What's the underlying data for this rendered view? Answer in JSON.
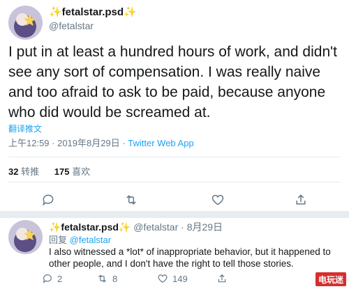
{
  "tweet": {
    "display_name": "✨fetalstar.psd✨",
    "handle": "@fetalstar",
    "text": "I put in at least a hundred hours of work, and didn't see any sort of compensation. I was really naive and too afraid to ask to be paid, because anyone who did would be screamed at.",
    "translate_label": "翻译推文",
    "timestamp": "上午12:59 · 2019年8月29日",
    "separator": " · ",
    "client": "Twitter Web App",
    "retweet_count": "32",
    "retweet_label": "转推",
    "like_count": "175",
    "like_label": "喜欢"
  },
  "icons": {
    "reply": "reply-icon",
    "retweet": "retweet-icon",
    "like": "heart-icon",
    "share": "share-icon"
  },
  "reply": {
    "display_name": "✨fetalstar.psd✨",
    "handle": "@fetalstar",
    "date": "· 8月29日",
    "reply_to_label": "回复",
    "reply_to_handle": "@fetalstar",
    "text": "I also witnessed a *lot* of inappropriate behavior, but it happened to other people, and I don't have the right to tell those stories.",
    "reply_count": "2",
    "retweet_count": "8",
    "like_count": "149"
  },
  "watermark": "电玩迷",
  "colors": {
    "accent": "#1da1f2",
    "muted": "#657786",
    "text": "#14171a",
    "divider": "#e6ecf0"
  }
}
